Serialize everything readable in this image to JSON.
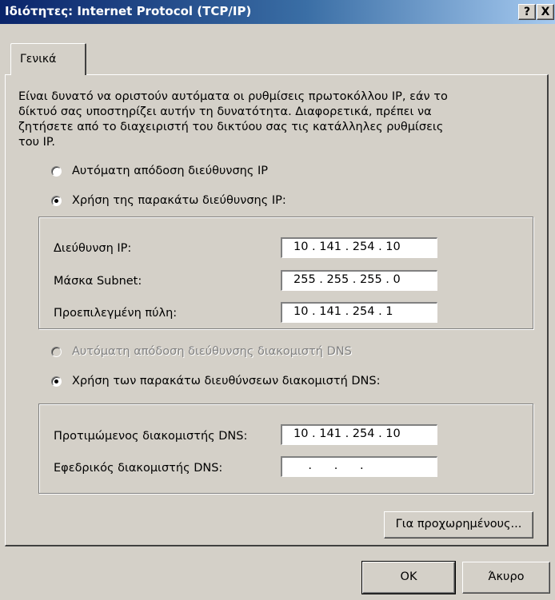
{
  "window": {
    "title": "Ιδιότητες: Internet Protocol (TCP/IP)",
    "help_button": "?",
    "close_button": "X"
  },
  "tabs": [
    {
      "label": "Γενικά"
    }
  ],
  "description": [
    "Είναι δυνατό να οριστούν αυτόματα οι ρυθμίσεις πρωτοκόλλου IP, εάν το",
    "δίκτυό σας υποστηρίζει αυτήν τη δυνατότητα. Διαφορετικά, πρέπει να",
    "ζητήσετε από το διαχειριστή του δικτύου σας τις κατάλληλες ρυθμίσεις",
    "του IP."
  ],
  "ip_options": {
    "auto": {
      "label": "Αυτόματη απόδοση διεύθυνσης IP",
      "checked": false
    },
    "manual": {
      "label": "Χρήση της παρακάτω διεύθυνσης IP:",
      "checked": true
    }
  },
  "ip_fields": {
    "ip_address": {
      "label": "Διεύθυνση IP:",
      "value": "10 . 141 . 254 . 10"
    },
    "subnet_mask": {
      "label": "Μάσκα Subnet:",
      "value": "255 . 255 . 255 . 0"
    },
    "gateway": {
      "label": "Προεπιλεγμένη πύλη:",
      "value": "10 . 141 . 254 . 1"
    }
  },
  "dns_options": {
    "auto": {
      "label": "Αυτόματη απόδοση διεύθυνσης διακομιστή DNS",
      "checked": false,
      "disabled": true
    },
    "manual": {
      "label": "Χρήση των παρακάτω διευθύνσεων διακομιστή DNS:",
      "checked": true
    }
  },
  "dns_fields": {
    "preferred": {
      "label": "Προτιμώμενος διακομιστής DNS:",
      "value": "10 . 141 . 254 . 10"
    },
    "alternate": {
      "label": "Εφεδρικός διακομιστής DNS:",
      "value": "    .      .      ."
    }
  },
  "buttons": {
    "advanced": "Για προχωρημένους...",
    "ok": "OK",
    "cancel": "Άκυρο"
  }
}
